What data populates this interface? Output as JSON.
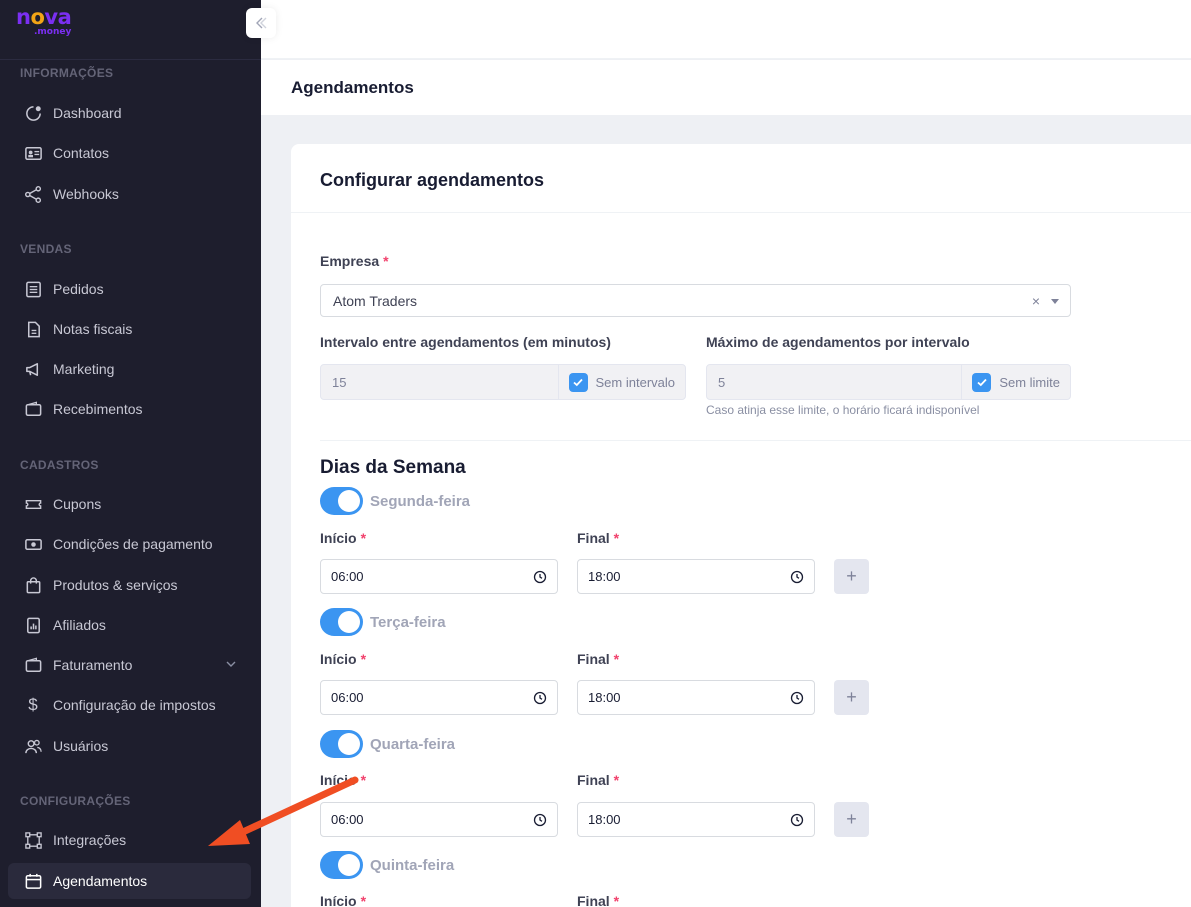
{
  "logo": {
    "text_nova_n": "n",
    "text_nova_o": "o",
    "text_nova_v": "v",
    "text_nova_a": "a",
    "text_money": ".money"
  },
  "sidebar": {
    "sections": {
      "informacoes": "INFORMAÇÕES",
      "vendas": "VENDAS",
      "cadastros": "CADASTROS",
      "configuracoes": "CONFIGURAÇÕES"
    },
    "items": {
      "dashboard": "Dashboard",
      "contatos": "Contatos",
      "webhooks": "Webhooks",
      "pedidos": "Pedidos",
      "notas": "Notas fiscais",
      "marketing": "Marketing",
      "recebimentos": "Recebimentos",
      "cupons": "Cupons",
      "condicoes": "Condições de pagamento",
      "produtos": "Produtos & serviços",
      "afiliados": "Afiliados",
      "faturamento": "Faturamento",
      "impostos": "Configuração de impostos",
      "usuarios": "Usuários",
      "integracoes": "Integrações",
      "agendamentos": "Agendamentos"
    },
    "icons": {
      "dollar": "$"
    }
  },
  "header": {
    "page_title": "Agendamentos"
  },
  "card": {
    "title": "Configurar agendamentos",
    "empresa_label": "Empresa",
    "required_mark": "*",
    "empresa_value": "Atom Traders",
    "clear_glyph": "×",
    "intervalo_label": "Intervalo entre agendamentos (em minutos)",
    "intervalo_value": "15",
    "sem_intervalo": "Sem intervalo",
    "maximo_label": "Máximo de agendamentos por intervalo",
    "maximo_value": "5",
    "sem_limite": "Sem limite",
    "hint": "Caso atinja esse limite, o horário ficará indisponível",
    "dias_title": "Dias da Semana",
    "inicio_label": "Início",
    "final_label": "Final",
    "add_glyph": "+"
  },
  "days": [
    {
      "name": "Segunda-feira",
      "inicio": "06:00",
      "final": "18:00",
      "enabled": true
    },
    {
      "name": "Terça-feira",
      "inicio": "06:00",
      "final": "18:00",
      "enabled": true
    },
    {
      "name": "Quarta-feira",
      "inicio": "06:00",
      "final": "18:00",
      "enabled": true
    },
    {
      "name": "Quinta-feira",
      "inicio": "",
      "final": "",
      "enabled": true
    }
  ],
  "colors": {
    "accent": "#3b95f1",
    "sidebar_bg": "#1e1e2d",
    "arrow": "#f04e23",
    "brand_purple": "#7b2ff2",
    "brand_orange": "#f2a516"
  }
}
